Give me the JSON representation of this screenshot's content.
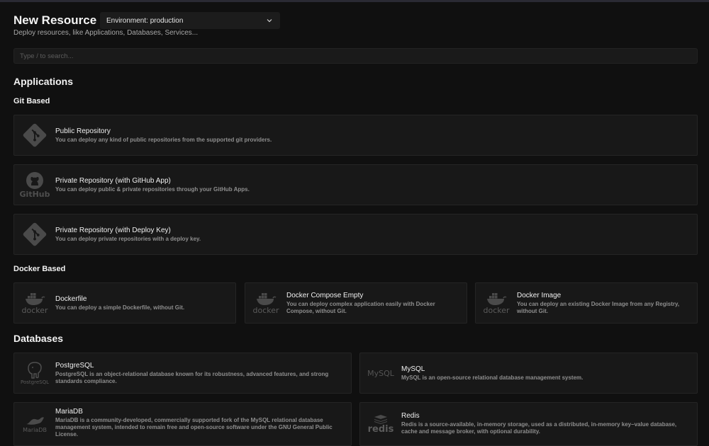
{
  "header": {
    "title": "New Resource",
    "subtitle": "Deploy resources, like Applications, Databases, Services...",
    "environment_select": "Environment: production"
  },
  "search": {
    "placeholder": "Type / to search..."
  },
  "sections": {
    "applications": "Applications",
    "git_based": "Git Based",
    "docker_based": "Docker Based",
    "databases": "Databases"
  },
  "git_cards": [
    {
      "name": "Public Repository",
      "desc": "You can deploy any kind of public repositories from the supported git providers.",
      "icon": "git-icon"
    },
    {
      "name": "Private Repository (with GitHub App)",
      "desc": "You can deploy public & private repositories through your GitHub Apps.",
      "icon": "github-icon",
      "icon_label": "GitHub"
    },
    {
      "name": "Private Repository (with Deploy Key)",
      "desc": "You can deploy private repositories with a deploy key.",
      "icon": "git-icon"
    }
  ],
  "docker_cards": [
    {
      "name": "Dockerfile",
      "desc": "You can deploy a simple Dockerfile, without Git.",
      "icon": "docker-icon",
      "icon_label": "docker"
    },
    {
      "name": "Docker Compose Empty",
      "desc": "You can deploy complex application easily with Docker Compose, without Git.",
      "icon": "docker-icon",
      "icon_label": "docker"
    },
    {
      "name": "Docker Image",
      "desc": "You can deploy an existing Docker Image from any Registry, without Git.",
      "icon": "docker-icon",
      "icon_label": "docker"
    }
  ],
  "database_cards": [
    {
      "name": "PostgreSQL",
      "desc": "PostgreSQL is an object-relational database known for its robustness, advanced features, and strong standards compliance.",
      "icon": "postgresql-icon",
      "icon_label": "PostgreSQL"
    },
    {
      "name": "MySQL",
      "desc": "MySQL is an open-source relational database management system.",
      "icon": "mysql-icon",
      "icon_label": "MySQL"
    },
    {
      "name": "MariaDB",
      "desc": "MariaDB is a community-developed, commercially supported fork of the MySQL relational database management system, intended to remain free and open-source software under the GNU General Public License.",
      "icon": "mariadb-icon",
      "icon_label": "MariaDB"
    },
    {
      "name": "Redis",
      "desc": "Redis is a source-available, in-memory storage, used as a distributed, in-memory key–value database, cache and message broker, with optional durability.",
      "icon": "redis-icon",
      "icon_label": "redis"
    }
  ],
  "colors": {
    "background": "#101010",
    "card": "#181818",
    "border": "#252525",
    "icon": "#4a4a4a"
  }
}
